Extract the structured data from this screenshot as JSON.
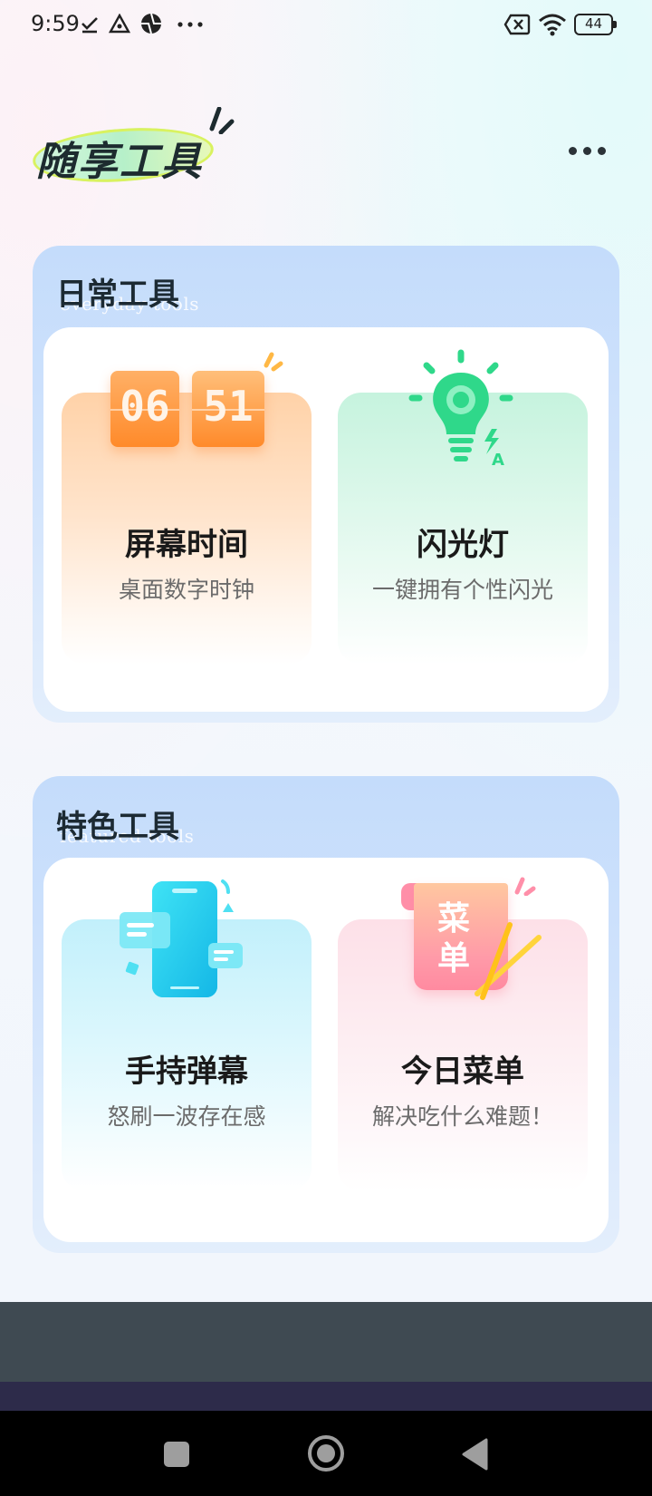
{
  "status_bar": {
    "time": "9:59",
    "battery": "44",
    "icons": [
      "check-icon",
      "warning-triangle-icon",
      "aperture-icon",
      "more-dots-icon",
      "sim-x-icon",
      "wifi-icon",
      "battery-icon"
    ]
  },
  "header": {
    "app_title": "随享工具",
    "more_icon": "more-horizontal-icon"
  },
  "sections": [
    {
      "title": "日常工具",
      "subtitle": "everyday tools",
      "cards": [
        {
          "title": "屏幕时间",
          "subtitle": "桌面数字时钟",
          "clock_hours": "06",
          "clock_minutes": "51",
          "icon": "flip-clock-icon"
        },
        {
          "title": "闪光灯",
          "subtitle": "一键拥有个性闪光",
          "icon": "lightbulb-icon",
          "badge": "A"
        }
      ]
    },
    {
      "title": "特色工具",
      "subtitle": "featured tools",
      "cards": [
        {
          "title": "手持弹幕",
          "subtitle": "怒刷一波存在感",
          "icon": "phone-chat-icon"
        },
        {
          "title": "今日菜单",
          "subtitle": "解决吃什么难题！",
          "icon": "menu-scroll-icon",
          "menu_label_1": "菜",
          "menu_label_2": "单"
        }
      ]
    }
  ],
  "colors": {
    "section_bg": "#c4dcfb",
    "card_orange": "#ffd8b0",
    "card_green": "#c9f5df",
    "card_cyan": "#c6f1fa",
    "card_pink": "#fde0ea",
    "nav_bar": "#000000"
  },
  "nav": {
    "buttons": [
      "recent-apps-icon",
      "home-icon",
      "back-icon"
    ]
  }
}
